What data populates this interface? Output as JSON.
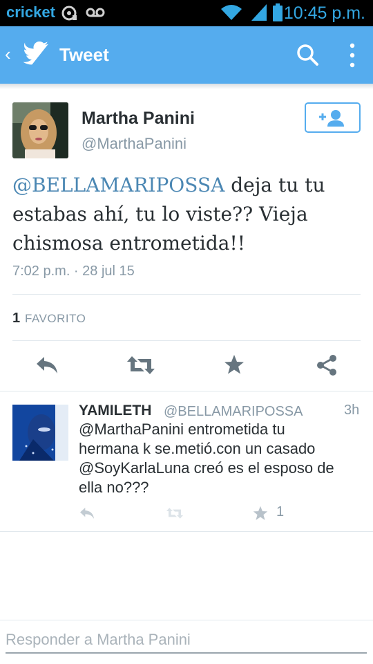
{
  "status_bar": {
    "carrier": "cricket",
    "time": "10:45 p.m."
  },
  "app_bar": {
    "title": "Tweet",
    "icons": [
      "chevron-left-icon",
      "twitter-bird-icon",
      "search-icon",
      "overflow-menu-icon"
    ]
  },
  "tweet": {
    "author_name": "Martha Panini",
    "author_handle": "@MarthaPanini",
    "mention": "@BELLAMARIPOSSA",
    "text_line1_rest": " deja tu tu",
    "text_line2": "estabas ahí, tu lo viste?? Vieja",
    "text_line3": "chismosa entrometida!!",
    "timestamp": "7:02 p.m. · 28 jul 15",
    "favorite_count": "1",
    "favorite_label": "FAVORITO"
  },
  "reply": {
    "author_name": "YAMILETH",
    "author_handle": "@BELLAMARIPOSSA",
    "time": "3h",
    "line1": "@MarthaPanini entrometida tu",
    "line2": "hermana k se.metió.con un casado",
    "line3": "@SoyKarlaLuna creó es el esposo de",
    "line4": "ella no???",
    "favorite_count": "1"
  },
  "compose": {
    "placeholder": "Responder a Martha Panini"
  },
  "colors": {
    "twitter_blue": "#55acee",
    "mention_blue": "#4b87b3",
    "text_dark": "#292f33",
    "text_gray": "#8899a6",
    "action_gray": "#66757f"
  }
}
